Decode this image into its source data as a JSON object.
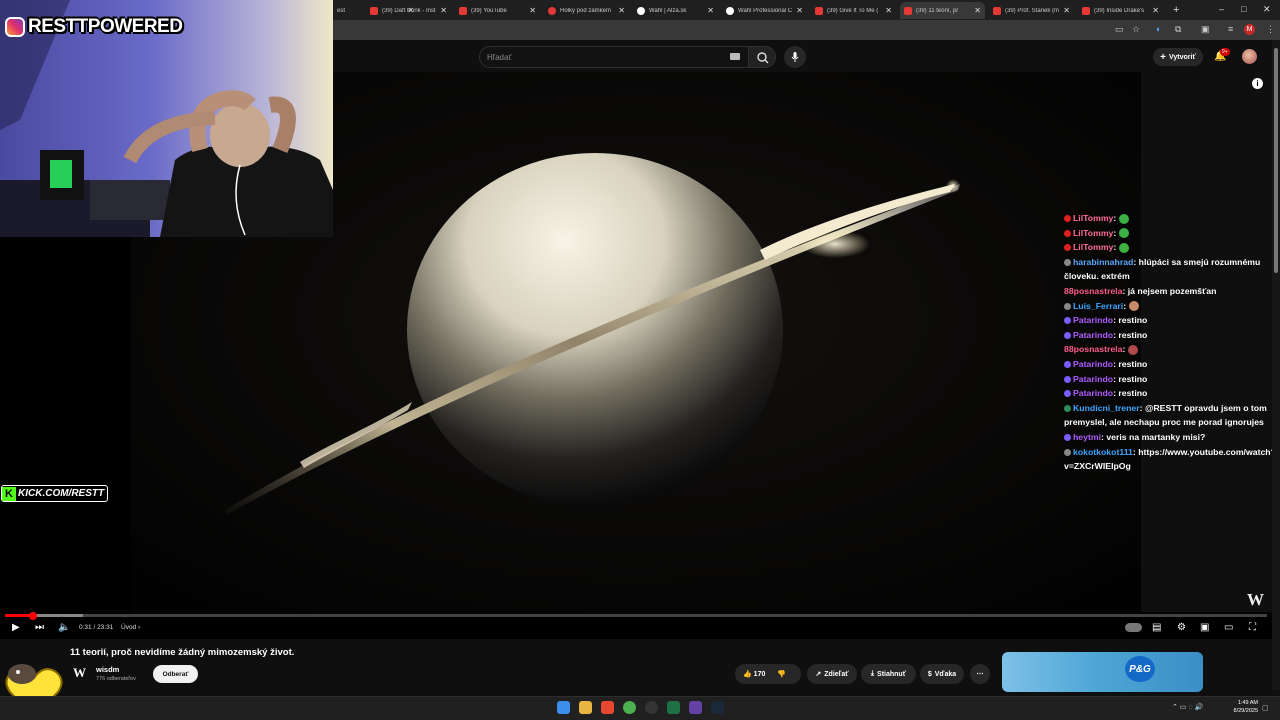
{
  "browser": {
    "tabs": [
      {
        "label": "est",
        "icon": "none"
      },
      {
        "label": "(39) Daft Punk - Inst",
        "icon": "youtube"
      },
      {
        "label": "(39) YouTube",
        "icon": "youtube"
      },
      {
        "label": "Holky pod zámkem",
        "icon": "red-dot"
      },
      {
        "label": "Wahl | Alza.sk",
        "icon": "alza"
      },
      {
        "label": "Wahl Professional C",
        "icon": "wahl"
      },
      {
        "label": "(39) Give It To Me (",
        "icon": "youtube"
      },
      {
        "label": "(39) 11 teorií, pr",
        "icon": "youtube",
        "active": true
      },
      {
        "label": "(39) Prof. Stanek (m",
        "icon": "youtube"
      },
      {
        "label": "(39) Inside Drake's",
        "icon": "youtube"
      }
    ],
    "new_tab": "+",
    "window_controls": [
      "–",
      "□",
      "✕"
    ]
  },
  "youtube": {
    "search_placeholder": "Hľadať",
    "create_label": "Vytvoriť",
    "notifications_badge": "9+"
  },
  "stream_overlay": {
    "channel": "RESTTPOWERED",
    "kick_label": "KICK.COM/RESTT"
  },
  "chat": [
    {
      "user": "LilTommy",
      "user_color": "#ff6b9a",
      "badge": "#e02020",
      "text": "",
      "emote": "#3cb043"
    },
    {
      "user": "LilTommy",
      "user_color": "#ff6b9a",
      "badge": "#e02020",
      "text": "",
      "emote": "#3cb043"
    },
    {
      "user": "LilTommy",
      "user_color": "#ff6b9a",
      "badge": "#e02020",
      "text": "",
      "emote": "#3cb043"
    },
    {
      "user": "harabinnahrad",
      "user_color": "#5aa9ff",
      "badge": "#888888",
      "text": "hlúpáci sa smejú rozumnému človeku. extrém"
    },
    {
      "user": "88posnastrela",
      "user_color": "#ff5c8a",
      "badge": "",
      "text": "já nejsem pozemšťan"
    },
    {
      "user": "Luis_Ferrari",
      "user_color": "#3da5ff",
      "badge": "#888888",
      "text": "",
      "emote": "#c98a6a"
    },
    {
      "user": "Patarindo",
      "user_color": "#b05cff",
      "badge": "#7a5cff",
      "text": "restino"
    },
    {
      "user": "Patarindo",
      "user_color": "#b05cff",
      "badge": "#7a5cff",
      "text": "restino"
    },
    {
      "user": "88posnastrela",
      "user_color": "#ff5c8a",
      "badge": "",
      "text": "",
      "emote": "#b04a4a"
    },
    {
      "user": "Patarindo",
      "user_color": "#b05cff",
      "badge": "#7a5cff",
      "text": "restino"
    },
    {
      "user": "Patarindo",
      "user_color": "#b05cff",
      "badge": "#7a5cff",
      "text": "restino"
    },
    {
      "user": "Patarindo",
      "user_color": "#b05cff",
      "badge": "#7a5cff",
      "text": "restino"
    },
    {
      "user": "Kundicni_trener",
      "user_color": "#3da5ff",
      "badge": "#2e8b57",
      "text": "@RESTT opravdu jsem o tom premyslel, ale nechapu proc me porad ignorujes"
    },
    {
      "user": "heytmi",
      "user_color": "#b05cff",
      "badge": "#7a5cff",
      "text": "veris na martanky misi?"
    },
    {
      "user": "kokotkokot111",
      "user_color": "#3da5ff",
      "badge": "#888888",
      "text": "https://www.youtube.com/watch?v=ZXCrWIEIpOg"
    }
  ],
  "player": {
    "time": "0:31 / 23:31",
    "chapter": "Úvod",
    "progress_fraction": 0.022,
    "buffered_fraction": 0.062,
    "watermark": "W"
  },
  "video_info": {
    "title": "11 teorií, proč nevidíme žádný mimozemský život.",
    "channel_name": "wisdm",
    "channel_logo": "W",
    "subscribers": "776 odberateľov",
    "subscribe_label": "Odberať",
    "likes": "170",
    "share_label": "Zdieľať",
    "download_label": "Stiahnuť",
    "thanks_label": "Vďaka",
    "more_label": "⋯"
  },
  "ad": {
    "brand": "P&G"
  },
  "taskbar": {
    "time": "1:49 AM",
    "date": "8/29/2025"
  }
}
